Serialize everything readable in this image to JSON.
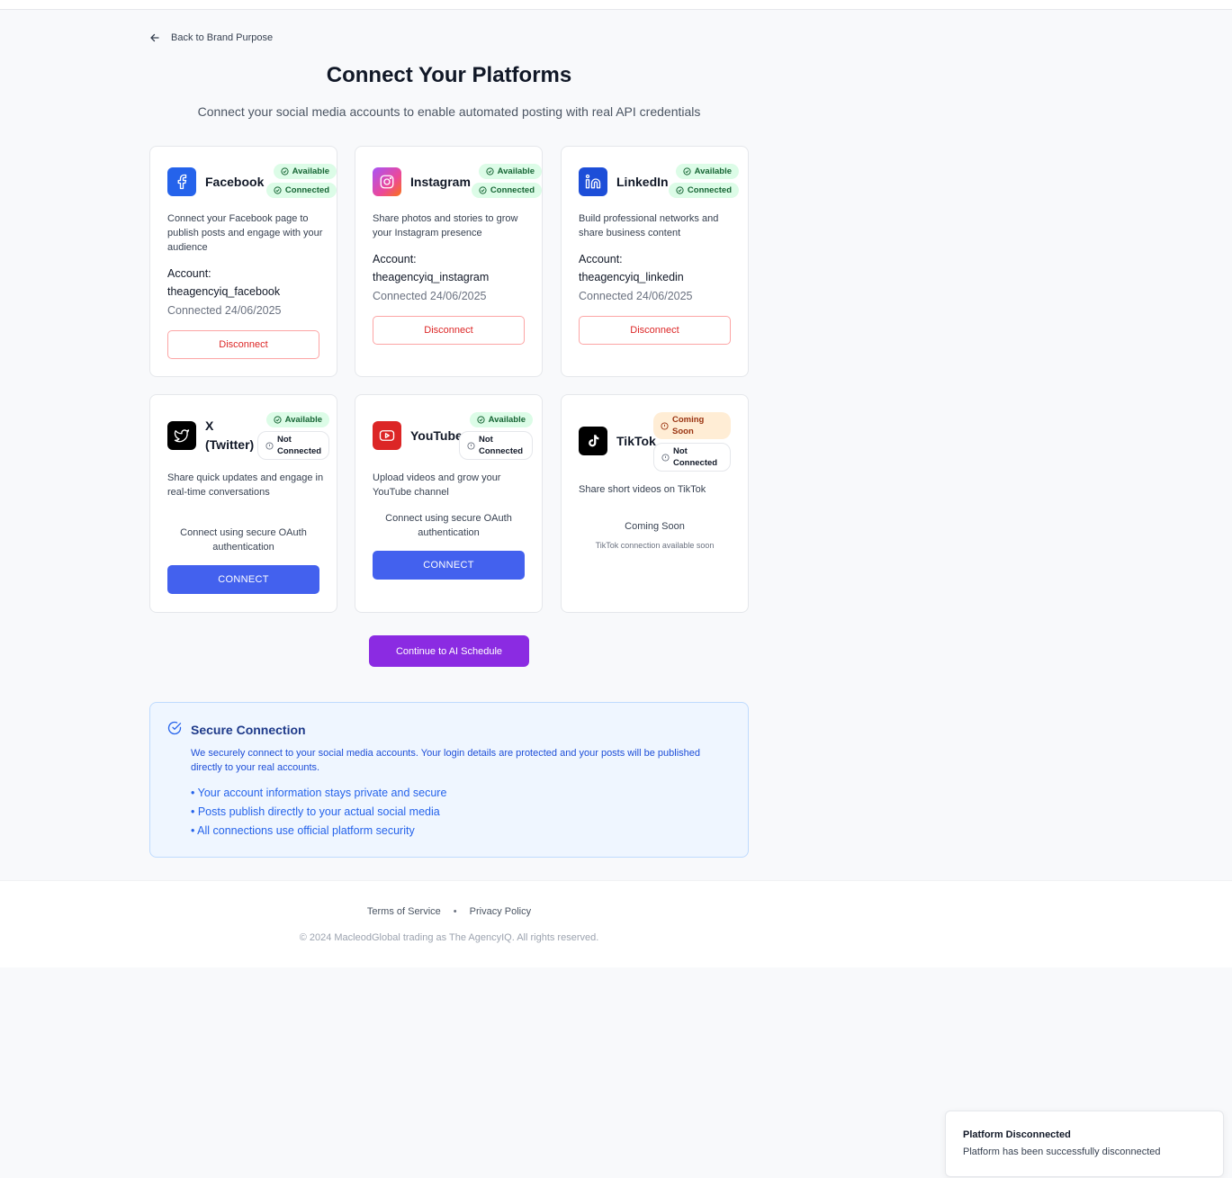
{
  "nav": {
    "back_label": "Back to Brand Purpose"
  },
  "header": {
    "title": "Connect Your Platforms",
    "subtitle": "Connect your social media accounts to enable automated posting with real API credentials"
  },
  "platforms": [
    {
      "name": "Facebook",
      "icon": "facebook-icon",
      "color": "#1877f2",
      "badges": [
        "Available",
        "Connected"
      ],
      "description": "Connect your Facebook page to publish posts and engage with your audience",
      "account_label": "Account:",
      "account_name": "theagencyiq_facebook",
      "connected_date": "Connected 24/06/2025",
      "action_label": "Disconnect"
    },
    {
      "name": "Instagram",
      "icon": "instagram-icon",
      "color": "#d62976",
      "badges": [
        "Available",
        "Connected"
      ],
      "description": "Share photos and stories to grow your Instagram presence",
      "account_label": "Account:",
      "account_name": "theagencyiq_instagram",
      "connected_date": "Connected 24/06/2025",
      "action_label": "Disconnect"
    },
    {
      "name": "LinkedIn",
      "icon": "linkedin-icon",
      "color": "#1d4ed8",
      "badges": [
        "Available",
        "Connected"
      ],
      "description": "Build professional networks and share business content",
      "account_label": "Account:",
      "account_name": "theagencyiq_linkedin",
      "connected_date": "Connected 24/06/2025",
      "action_label": "Disconnect"
    },
    {
      "name": "X (Twitter)",
      "icon": "twitter-icon",
      "color": "#000000",
      "badges": [
        "Available",
        "Not Connected"
      ],
      "description": "Share quick updates and engage in real-time conversations",
      "oauth_text": "Connect using secure OAuth authentication",
      "action_label": "CONNECT"
    },
    {
      "name": "YouTube",
      "icon": "youtube-icon",
      "color": "#dc2626",
      "badges": [
        "Available",
        "Not Connected"
      ],
      "description": "Upload videos and grow your YouTube channel",
      "oauth_text": "Connect using secure OAuth authentication",
      "action_label": "CONNECT"
    },
    {
      "name": "TikTok",
      "icon": "tiktok-icon",
      "color": "#000000",
      "badges": [
        "Coming Soon",
        "Not Connected"
      ],
      "description": "Share short videos on TikTok",
      "soon_title": "Coming Soon",
      "soon_sub": "TikTok connection available soon"
    }
  ],
  "continue_label": "Continue to AI Schedule",
  "secure": {
    "title": "Secure Connection",
    "description": "We securely connect to your social media accounts. Your login details are protected and your posts will be published directly to your real accounts.",
    "bullets": [
      "• Your account information stays private and secure",
      "• Posts publish directly to your actual social media",
      "• All connections use official platform security"
    ]
  },
  "footer": {
    "terms": "Terms of Service",
    "separator": "•",
    "privacy": "Privacy Policy",
    "copyright": "© 2024 MacleodGlobal trading as The AgencyIQ. All rights reserved."
  },
  "toast": {
    "title": "Platform Disconnected",
    "message": "Platform has been successfully disconnected"
  }
}
